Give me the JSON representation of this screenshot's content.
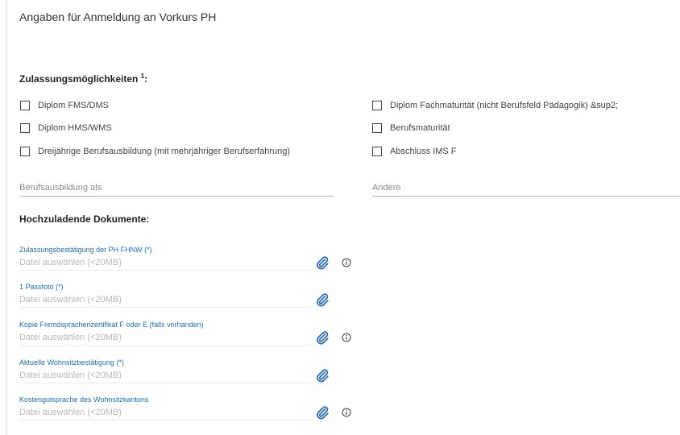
{
  "form": {
    "title": "Angaben für Anmeldung an Vorkurs PH",
    "admission": {
      "heading": "Zulassungsmöglichkeiten",
      "footnote": "1",
      "heading_colon": ":",
      "options_left": [
        {
          "label": "Diplom FMS/DMS",
          "checked": false
        },
        {
          "label": "Diplom HMS/WMS",
          "checked": false
        },
        {
          "label": "Dreijährige Berufsausbildung (mit mehrjähriger Berufserfahrung)",
          "checked": false
        }
      ],
      "options_right": [
        {
          "label": "Diplom Fachmaturität (nicht Berufsfeld Pädagogik) &sup2;",
          "checked": false
        },
        {
          "label": "Berufsmaturität",
          "checked": false
        },
        {
          "label": "Abschluss IMS F",
          "checked": false
        }
      ]
    },
    "fields": {
      "training_placeholder": "Berufsausbildung als",
      "other_placeholder": "Andere"
    },
    "documents": {
      "heading": "Hochzuladende Dokumente:",
      "items": [
        {
          "label": "Zulassungsbestätigung der PH FHNW (*)",
          "placeholder": "Datei auswählen (<20MB)",
          "has_info": true
        },
        {
          "label": "1 Passfoto (*)",
          "placeholder": "Datei auswählen (<20MB)",
          "has_info": false
        },
        {
          "label": "Kopie Fremdsprachenzertifikat F oder E (falls vorhanden)",
          "placeholder": "Datei auswählen (<20MB)",
          "has_info": true
        },
        {
          "label": "Aktuelle Wohnsitzbestätigung (*)",
          "placeholder": "Datei auswählen (<20MB)",
          "has_info": false
        },
        {
          "label": "Kostengutsprache des Wohnsitzkantons",
          "placeholder": "Datei auswählen (<20MB)",
          "has_info": true
        }
      ]
    },
    "icons": {
      "attach": "paperclip-icon",
      "info": "info-icon"
    },
    "colors": {
      "link_blue": "#1f6fb5",
      "clip_blue": "#2a6db5",
      "text": "#333333"
    }
  }
}
